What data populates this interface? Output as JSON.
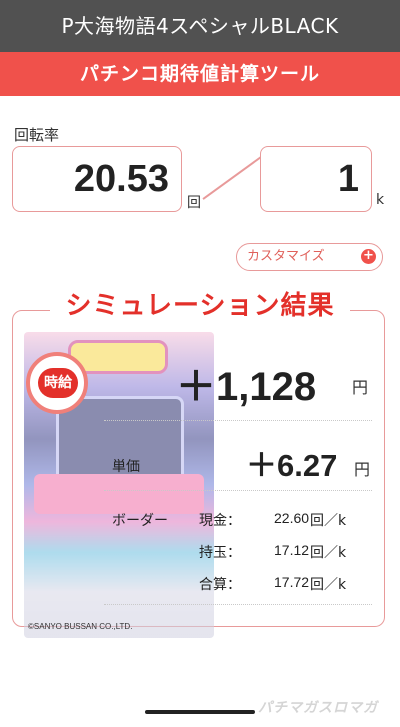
{
  "header": {
    "title": "P大海物語4スペシャルBLACK",
    "subtitle": "パチンコ期待値計算ツール"
  },
  "input": {
    "rate_label": "回転率",
    "rate_value": "20.53",
    "rate_unit": "回",
    "per_value": "1",
    "per_unit": "k"
  },
  "customize": {
    "label": "カスタマイズ",
    "icon": "plus-circle-icon"
  },
  "result": {
    "title": "シミュレーション結果",
    "hourly_label": "時給",
    "hourly_value": "＋1,128",
    "hourly_unit": "円",
    "unit_price_label": "単価",
    "unit_price_value": "＋6.27",
    "unit_price_unit": "円",
    "border_label": "ボーダー",
    "border_rows": [
      {
        "label": "現金：",
        "value": "22.60",
        "unit": "回／k"
      },
      {
        "label": "持玉：",
        "value": "17.12",
        "unit": "回／k"
      },
      {
        "label": "合算：",
        "value": "17.72",
        "unit": "回／k"
      }
    ],
    "copyright": "©SANYO BUSSAN CO.,LTD."
  },
  "footer": {
    "watermark": "パチマガスロマガ"
  },
  "colors": {
    "accent": "#f0514b",
    "title_bar": "#515151",
    "result_title": "#e3302a",
    "border": "#e89a9a"
  }
}
